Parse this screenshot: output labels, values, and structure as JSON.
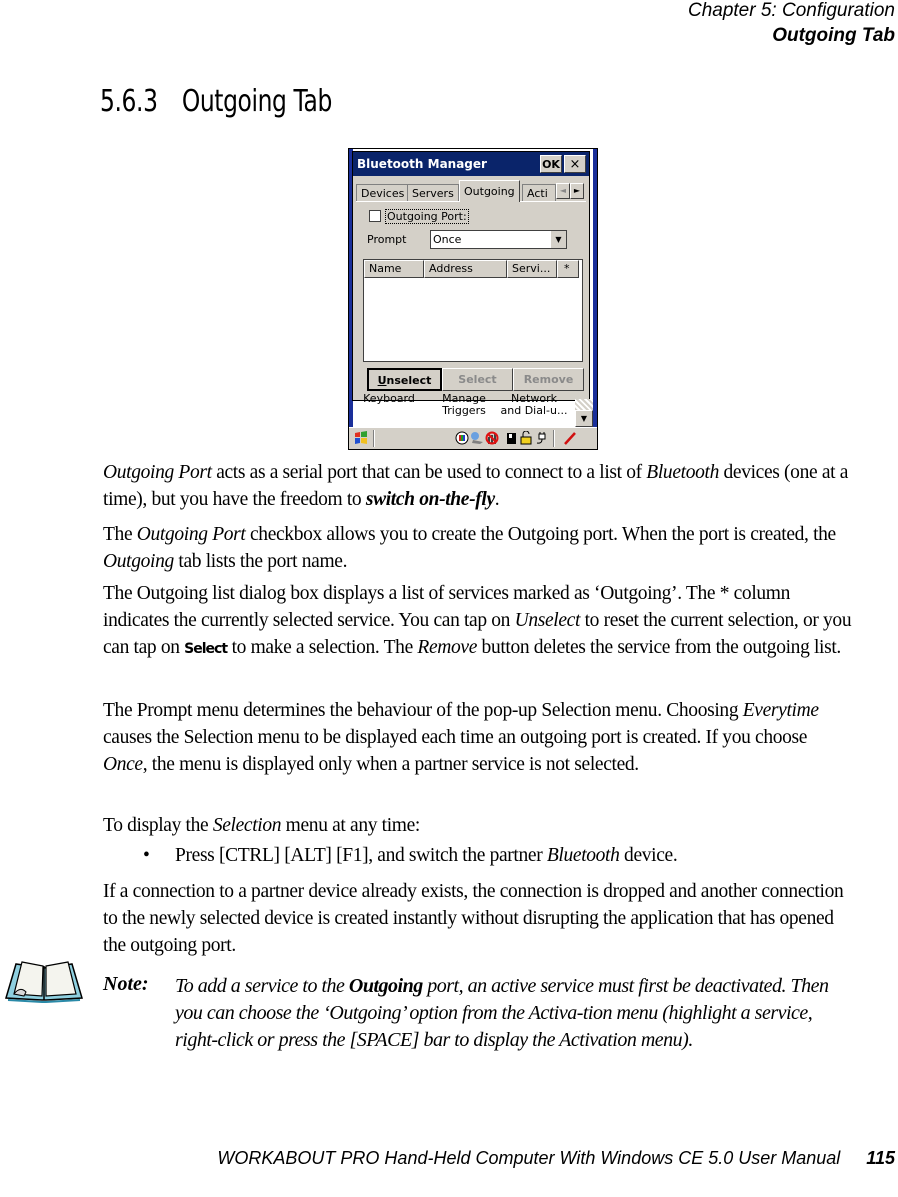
{
  "header": {
    "chapter": "Chapter  5:  Configuration",
    "section": "Outgoing Tab"
  },
  "section_title": {
    "number": "5.6.3",
    "title": "Outgoing Tab"
  },
  "screenshot": {
    "window_title": "Bluetooth Manager",
    "ok_label": "OK",
    "close_label": "×",
    "tabs": [
      {
        "label": "Devices",
        "active": false
      },
      {
        "label": "Servers",
        "active": false
      },
      {
        "label": "Outgoing",
        "active": true
      },
      {
        "label": "Acti",
        "active": false
      }
    ],
    "tab_scroll_left": "◄",
    "tab_scroll_right": "►",
    "outgoing_port_checkbox": {
      "label": "Outgoing Port:",
      "checked": false
    },
    "prompt": {
      "label": "Prompt",
      "value": "Once",
      "dropdown_icon": "▼"
    },
    "columns": [
      "Name",
      "Address",
      "Servi...",
      "*"
    ],
    "rows": [],
    "buttons": {
      "unselect_underline": "U",
      "unselect_rest": "nselect",
      "select": "Select",
      "remove": "Remove"
    },
    "background_items": [
      {
        "line1": "Keyboard",
        "line2": ""
      },
      {
        "line1": "Manage",
        "line2": "Triggers"
      },
      {
        "line1": "Network",
        "line2": "and Dial-u..."
      }
    ],
    "scroll_down_icon": "▼",
    "taskbar": {
      "start_icon": "windows-flag-icon",
      "tray_icons": [
        "network-globe-icon",
        "connection-icon",
        "no-signal-icon",
        "battery-icon",
        "lock-icon",
        "power-plug-icon",
        "pen-icon"
      ]
    }
  },
  "paragraphs": {
    "p1": {
      "a_italic": "Outgoing Port",
      "b": " acts as a serial port that can be used to connect to a list of ",
      "c_italic": "Bluetooth",
      "d": " devices (one at a time), but you have the freedom to ",
      "e_bolditalic": "switch on-the-fly",
      "f": "."
    },
    "p2": {
      "a": "The ",
      "b_italic": "Outgoing Port",
      "c": "  checkbox allows you to create the Outgoing port. When the port is created, the ",
      "d_italic": "Outgoing",
      "e": " tab lists the port name."
    },
    "p3": {
      "a": "The Outgoing list dialog box displays a list of services marked as ‘Outgoing’. The * column indicates the currently selected service. You can tap on ",
      "b_italic": "Unselect",
      "c": " to reset the current selection, or you can tap on ",
      "d_select": "Select",
      "e": " to make a selection. The ",
      "f_italic": "Remove",
      "g": " button deletes the service from the outgoing list."
    },
    "p4": {
      "a": "The Prompt menu determines the behaviour of the pop-up Selection menu. Choosing ",
      "b_italic": "Everytime",
      "c": " causes the Selection menu to be displayed each time an outgoing port is created. If you choose ",
      "d_italic": "Once",
      "e": ", the menu is displayed only when a partner service is not selected."
    },
    "p5": {
      "a": "To display the ",
      "b_italic": "Selection",
      "c": " menu at any time:"
    },
    "bullet": {
      "mark": "•",
      "a": "Press [CTRL] [ALT] [F1], and switch the partner ",
      "b_italic": "Bluetooth",
      "c": " device."
    },
    "p6": "If a connection to a partner device already exists, the connection is dropped and another connection to the newly selected device is created instantly without disrupting the application that has opened the outgoing port."
  },
  "note": {
    "label": "Note:",
    "a": "To add a service to the ",
    "b_bold": "Outgoing",
    "c": " port, an active service must first be deactivated. Then you can choose the ‘Outgoing’ option from the Activa-tion menu (highlight a service, right-click or press the [SPACE] bar to display the Activation menu)."
  },
  "footer": {
    "title": "WORKABOUT PRO Hand-Held Computer With Windows CE 5.0 User Manual",
    "page": "115"
  }
}
